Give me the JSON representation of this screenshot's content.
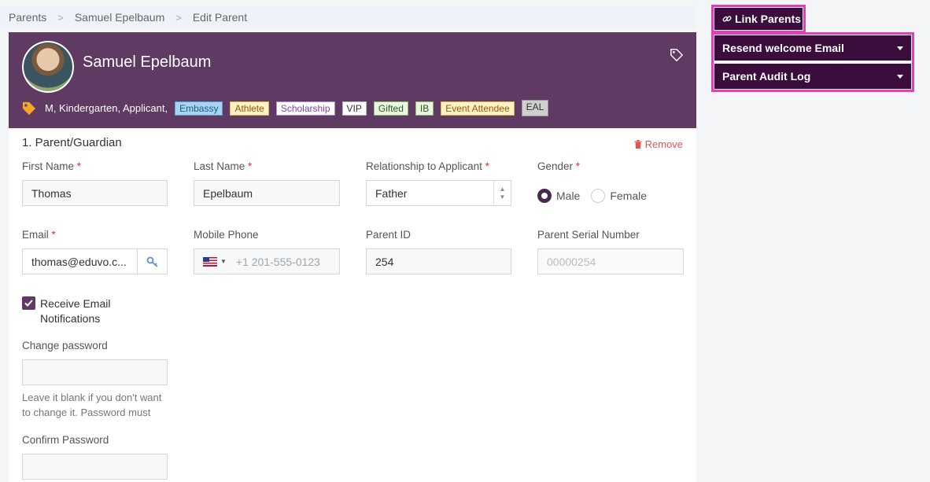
{
  "breadcrumb": {
    "items": [
      "Parents",
      "Samuel Epelbaum",
      "Edit Parent"
    ],
    "separator": ">"
  },
  "student": {
    "name": "Samuel Epelbaum",
    "summary": "M, Kindergarten, Applicant,",
    "tags": [
      "Embassy",
      "Athlete",
      "Scholarship",
      "VIP",
      "Gifted",
      "IB",
      "Event Attendee",
      "EAL"
    ]
  },
  "section": {
    "title": "1. Parent/Guardian",
    "remove_label": "Remove"
  },
  "form": {
    "first_name": {
      "label": "First Name",
      "value": "Thomas",
      "required": "*"
    },
    "last_name": {
      "label": "Last Name",
      "value": "Epelbaum",
      "required": "*"
    },
    "relationship": {
      "label": "Relationship to Applicant",
      "value": "Father",
      "required": "*"
    },
    "gender": {
      "label": "Gender",
      "required": "*",
      "options": [
        "Male",
        "Female"
      ],
      "selected": "Male"
    },
    "email": {
      "label": "Email",
      "value": "thomas@eduvo.c...",
      "required": "*"
    },
    "mobile_phone": {
      "label": "Mobile Phone",
      "placeholder": "+1 201-555-0123"
    },
    "parent_id": {
      "label": "Parent ID",
      "value": "254"
    },
    "serial_number": {
      "label": "Parent Serial Number",
      "placeholder": "00000254"
    },
    "receive_email": {
      "label": "Receive Email Notifications",
      "checked": true
    },
    "change_password": {
      "label": "Change password",
      "help": "Leave it blank if you don't want to change it. Password must"
    },
    "confirm_password": {
      "label": "Confirm Password"
    }
  },
  "sidebar": {
    "link_parents": "Link Parents",
    "resend_email": "Resend welcome Email",
    "audit_log": "Parent Audit Log"
  },
  "colors": {
    "header": "#5f3a63",
    "sidebar_button": "#3b0d3d",
    "highlight": "#e040b8",
    "required": "#e03030"
  }
}
